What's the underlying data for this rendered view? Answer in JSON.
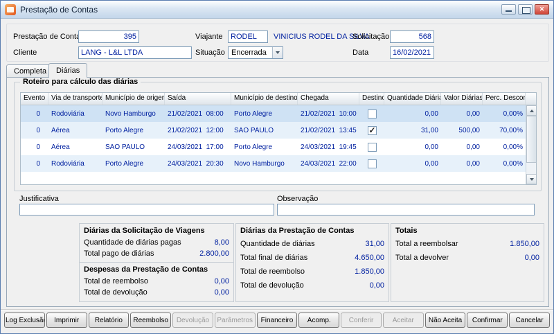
{
  "window": {
    "title": "Prestação de Contas"
  },
  "colors": {
    "accent_text": "#0020a0",
    "selected_row": "#cfe2f4"
  },
  "header": {
    "prestacao_label": "Prestação de Contas",
    "prestacao_value": "395",
    "viajante_label": "Viajante",
    "viajante_code": "RODEL",
    "viajante_name": "VINICIUS RODEL DA SILVA",
    "solicitacao_label": "Solicitação",
    "solicitacao_value": "568",
    "cliente_label": "Cliente",
    "cliente_value": "LANG - L&L LTDA",
    "situacao_label": "Situação",
    "situacao_value": "Encerrada",
    "data_label": "Data",
    "data_value": "16/02/2021"
  },
  "tabs": [
    {
      "label": "Completa",
      "active": false
    },
    {
      "label": "Diárias",
      "active": true
    }
  ],
  "roteiro": {
    "title": "Roteiro para cálculo das diárias",
    "columns": [
      "Evento",
      "Via de transporte",
      "Município de origem",
      "Saída",
      "Município de destino",
      "Chegada",
      "Destino",
      "Quantidade Diárias",
      "Valor Diárias",
      "Perc. Desconto"
    ],
    "rows": [
      {
        "selected": true,
        "evento": "0",
        "via": "Rodoviária",
        "origem": "Novo Hamburgo",
        "saida": "21/02/2021  08:00",
        "destino_municipio": "Porto Alegre",
        "chegada": "21/02/2021  10:00",
        "destino": false,
        "quantidade": "0,00",
        "valor": "0,00",
        "desconto": "0,00%"
      },
      {
        "selected": false,
        "evento": "0",
        "via": "Aérea",
        "origem": "Porto Alegre",
        "saida": "21/02/2021  12:00",
        "destino_municipio": "SAO PAULO",
        "chegada": "21/02/2021  13:45",
        "destino": true,
        "quantidade": "31,00",
        "valor": "500,00",
        "desconto": "70,00%"
      },
      {
        "selected": false,
        "evento": "0",
        "via": "Aérea",
        "origem": "SAO PAULO",
        "saida": "24/03/2021  17:00",
        "destino_municipio": "Porto Alegre",
        "chegada": "24/03/2021  19:45",
        "destino": false,
        "quantidade": "0,00",
        "valor": "0,00",
        "desconto": "0,00%"
      },
      {
        "selected": false,
        "evento": "0",
        "via": "Rodoviária",
        "origem": "Porto Alegre",
        "saida": "24/03/2021  20:30",
        "destino_municipio": "Novo Hamburgo",
        "chegada": "24/03/2021  22:00",
        "destino": false,
        "quantidade": "0,00",
        "valor": "0,00",
        "desconto": "0,00%"
      }
    ]
  },
  "fields": {
    "justificativa_label": "Justificativa",
    "justificativa_value": "",
    "observacao_label": "Observação",
    "observacao_value": ""
  },
  "panels": {
    "solicitacao": {
      "title": "Diárias da Solicitação de Viagens",
      "rows": [
        {
          "label": "Quantidade de diárias pagas",
          "value": "8,00"
        },
        {
          "label": "Total pago de diárias",
          "value": "2.800,00"
        }
      ]
    },
    "despesas": {
      "title": "Despesas da Prestação de Contas",
      "rows": [
        {
          "label": "Total de reembolso",
          "value": "0,00"
        },
        {
          "label": "Total de devolução",
          "value": "0,00"
        }
      ]
    },
    "prestacao": {
      "title": "Diárias da Prestação de Contas",
      "rows": [
        {
          "label": "Quantidade de diárias",
          "value": "31,00"
        },
        {
          "label": "Total final de diárias",
          "value": "4.650,00"
        },
        {
          "label": "Total de reembolso",
          "value": "1.850,00"
        },
        {
          "label": "Total de devolução",
          "value": "0,00"
        }
      ]
    },
    "totais": {
      "title": "Totais",
      "rows": [
        {
          "label": "Total a reembolsar",
          "value": "1.850,00"
        },
        {
          "label": "Total a devolver",
          "value": "0,00"
        }
      ]
    }
  },
  "footer": {
    "buttons": [
      {
        "label": "Log Exclusão",
        "disabled": false
      },
      {
        "label": "Imprimir",
        "disabled": false
      },
      {
        "label": "Relatório",
        "disabled": false
      },
      {
        "label": "Reembolso",
        "disabled": false
      },
      {
        "label": "Devolução",
        "disabled": true
      },
      {
        "label": "Parâmetros",
        "disabled": true
      },
      {
        "label": "Financeiro",
        "disabled": false
      },
      {
        "label": "Acomp.",
        "disabled": false
      },
      {
        "label": "Conferir",
        "disabled": true
      },
      {
        "label": "Aceitar",
        "disabled": true
      },
      {
        "label": "Não Aceita",
        "disabled": false
      },
      {
        "label": "Confirmar",
        "disabled": false
      },
      {
        "label": "Cancelar",
        "disabled": false
      }
    ]
  }
}
